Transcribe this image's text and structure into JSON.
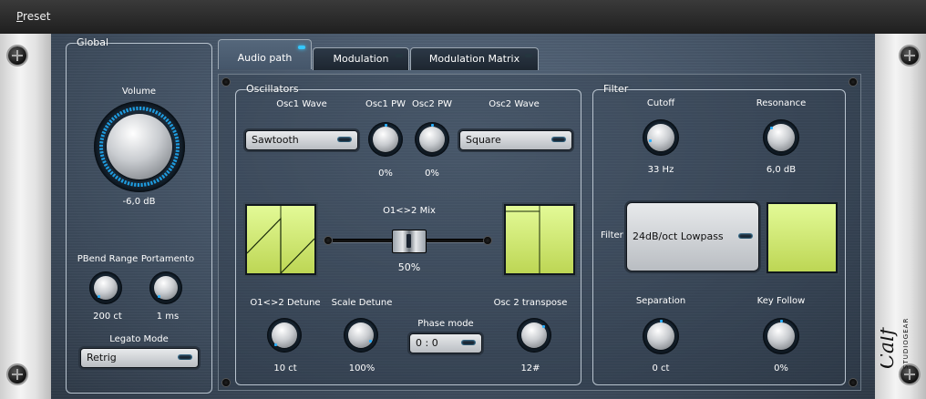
{
  "menubar": {
    "preset_label": "Preset"
  },
  "global": {
    "title": "Global",
    "volume": {
      "label": "Volume",
      "value": "-6,0 dB"
    },
    "pbend": {
      "label": "PBend Range",
      "value": "200 ct"
    },
    "portamento": {
      "label": "Portamento",
      "value": "1 ms"
    },
    "legato": {
      "label": "Legato Mode",
      "selected": "Retrig"
    }
  },
  "tabs": [
    {
      "label": "Audio path",
      "active": true
    },
    {
      "label": "Modulation",
      "active": false
    },
    {
      "label": "Modulation Matrix",
      "active": false
    }
  ],
  "oscillators": {
    "title": "Oscillators",
    "osc1_wave": {
      "label": "Osc1 Wave",
      "selected": "Sawtooth"
    },
    "osc1_pw": {
      "label": "Osc1 PW",
      "value": "0%"
    },
    "osc2_pw": {
      "label": "Osc2 PW",
      "value": "0%"
    },
    "osc2_wave": {
      "label": "Osc2 Wave",
      "selected": "Square"
    },
    "mix": {
      "label": "O1<>2 Mix",
      "value": "50%",
      "level": 0.5
    },
    "detune": {
      "label": "O1<>2 Detune",
      "value": "10 ct"
    },
    "scale_detune": {
      "label": "Scale Detune",
      "value": "100%"
    },
    "phase_mode": {
      "label": "Phase mode",
      "selected": "0 : 0"
    },
    "transpose": {
      "label": "Osc 2 transpose",
      "value": "12#"
    }
  },
  "filter": {
    "title": "Filter",
    "cutoff": {
      "label": "Cutoff",
      "value": "33 Hz"
    },
    "resonance": {
      "label": "Resonance",
      "value": "6,0 dB"
    },
    "type": {
      "label": "Filter",
      "selected": "24dB/oct Lowpass"
    },
    "separation": {
      "label": "Separation",
      "value": "0 ct"
    },
    "key_follow": {
      "label": "Key Follow",
      "value": "0%"
    }
  },
  "colors": {
    "accent_led": "#35c8ff",
    "display_green": "#d4ef7a",
    "panel_blue": "#4a5a6c"
  }
}
